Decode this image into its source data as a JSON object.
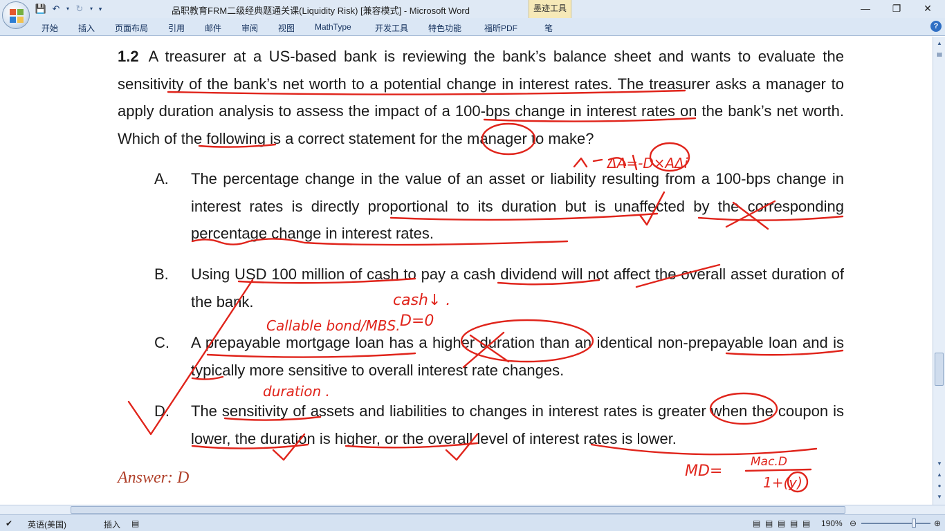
{
  "window": {
    "title": "品职教育FRM二级经典题通关课(Liquidity Risk) [兼容模式] - Microsoft Word",
    "contextual_tab": "墨迹工具"
  },
  "ribbon_tabs": [
    "开始",
    "插入",
    "页面布局",
    "引用",
    "邮件",
    "审阅",
    "视图",
    "MathType",
    "开发工具",
    "特色功能",
    "福昕PDF",
    "笔"
  ],
  "document": {
    "question_number": "1.2",
    "question_text": "A treasurer at a US-based bank is reviewing the bank’s balance sheet and wants to evaluate the sensitivity of the bank’s net worth to a potential change in interest rates. The treasurer asks a manager to apply duration analysis to assess the impact of a 100-bps change in interest rates on the bank’s net worth. Which of the following is a correct statement for the manager to make?",
    "options": [
      {
        "letter": "A.",
        "text": "The percentage change in the value of an asset or liability resulting from a 100-bps change in interest rates is directly proportional to its duration but is unaffected by the corresponding percentage change in interest rates."
      },
      {
        "letter": "B.",
        "text": "Using USD 100 million of cash to pay a cash dividend will not affect the overall asset duration of the bank."
      },
      {
        "letter": "C.",
        "text": "A prepayable mortgage loan has a higher duration than an identical non-prepayable loan and is typically more sensitive to overall interest rate changes."
      },
      {
        "letter": "D.",
        "text": "The sensitivity of assets and liabilities to changes in interest rates is greater when the coupon is lower, the duration is higher, or the overall level of interest rates is lower."
      }
    ],
    "answer": "Answer: D"
  },
  "statusbar": {
    "language": "英语(美国)",
    "mode": "插入",
    "zoom": "190%",
    "zoom_level": 0.76
  },
  "colors": {
    "ink": "#e0241b",
    "answer": "#b0402a",
    "ribbon": "#dbe7f5"
  }
}
